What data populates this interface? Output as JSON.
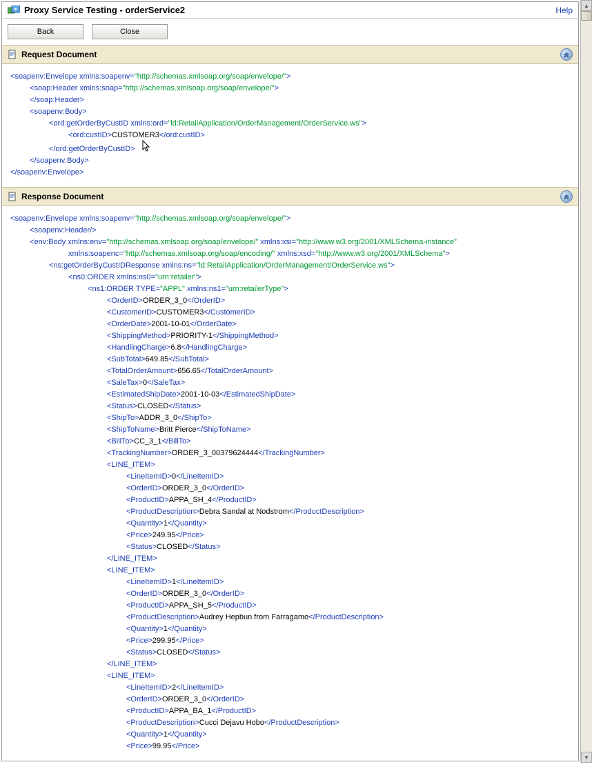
{
  "header": {
    "title": "Proxy Service Testing - orderService2",
    "help": "Help"
  },
  "buttons": {
    "back": "Back",
    "close": "Close"
  },
  "sections": {
    "request_title": "Request Document",
    "response_title": "Response Document"
  },
  "request": {
    "envelope_open": "soapenv:Envelope",
    "ns_soapenv_attr": "xmlns:soapenv",
    "ns_soapenv_val": "\"http://schemas.xmlsoap.org/soap/envelope/\"",
    "soap_header": "soap:Header",
    "ns_soap_attr": "xmlns:soap",
    "ns_soap_val": "\"http://schemas.xmlsoap.org/soap/envelope/\"",
    "soap_header_close": "/soap:Header",
    "body_open": "soapenv:Body",
    "op_open": "ord:getOrderByCustID",
    "ns_ord_attr": "xmlns:ord",
    "ns_ord_val": "\"ld:RetailApplication/OrderManagement/OrderService.ws\"",
    "custid_tag": "ord:custID",
    "custid_val": "CUSTOMER3",
    "op_close": "/ord:getOrderByCustID",
    "body_close": "/soapenv:Body",
    "envelope_close": "/soapenv:Envelope"
  },
  "response": {
    "envelope_open": "soapenv:Envelope",
    "ns_soapenv_attr": "xmlns:soapenv",
    "ns_soapenv_val": "\"http://schemas.xmlsoap.org/soap/envelope/\"",
    "header": "soapenv:Header/",
    "body_open": "env:Body",
    "ns_env_attr": "xmlns:env",
    "ns_env_val": "\"http://schemas.xmlsoap.org/soap/envelope/\"",
    "ns_xsi_attr": "xmlns:xsi",
    "ns_xsi_val": "\"http://www.w3.org/2001/XMLSchema-instance\"",
    "ns_soapenc_attr": "xmlns:soapenc",
    "ns_soapenc_val": "\"http://schemas.xmlsoap.org/soap/encoding/\"",
    "ns_xsd_attr": "xmlns:xsd",
    "ns_xsd_val": "\"http://www.w3.org/2001/XMLSchema\"",
    "resp_open": "ns:getOrderByCustIDResponse",
    "ns_ns_attr": "xmlns:ns",
    "ns_ns_val": "\"ld:RetailApplication/OrderManagement/OrderService.ws\"",
    "ns0order_open": "ns0:ORDER",
    "ns_ns0_attr": "xmlns:ns0",
    "ns_ns0_val": "\"urn:retailer\"",
    "ns1order_open": "ns1:ORDER",
    "type_attr": "TYPE",
    "type_val": "\"APPL\"",
    "ns_ns1_attr": "xmlns:ns1",
    "ns_ns1_val": "\"urn:retailerType\"",
    "fields": {
      "OrderID": "ORDER_3_0",
      "CustomerID": "CUSTOMER3",
      "OrderDate": "2001-10-01",
      "ShippingMethod": "PRIORITY-1",
      "HandlingCharge": "6.8",
      "SubTotal": "649.85",
      "TotalOrderAmount": "656.65",
      "SaleTax": "0",
      "EstimatedShipDate": "2001-10-03",
      "Status": "CLOSED",
      "ShipTo": "ADDR_3_0",
      "ShipToName": "Britt Pierce",
      "BillTo": "CC_3_1",
      "TrackingNumber": "ORDER_3_00379624444"
    },
    "line_item_tag": "LINE_ITEM",
    "line_items": [
      {
        "LineItemID": "0",
        "OrderID": "ORDER_3_0",
        "ProductID": "APPA_SH_4",
        "ProductDescription": "Debra Sandal at Nodstrom",
        "Quantity": "1",
        "Price": "249.95",
        "Status": "CLOSED"
      },
      {
        "LineItemID": "1",
        "OrderID": "ORDER_3_0",
        "ProductID": "APPA_SH_5",
        "ProductDescription": "Audrey Hepbun from Farragamo",
        "Quantity": "1",
        "Price": "299.95",
        "Status": "CLOSED"
      },
      {
        "LineItemID": "2",
        "OrderID": "ORDER_3_0",
        "ProductID": "APPA_BA_1",
        "ProductDescription": "Cucci Dejavu Hobo",
        "Quantity": "1",
        "Price": "99.95"
      }
    ]
  }
}
